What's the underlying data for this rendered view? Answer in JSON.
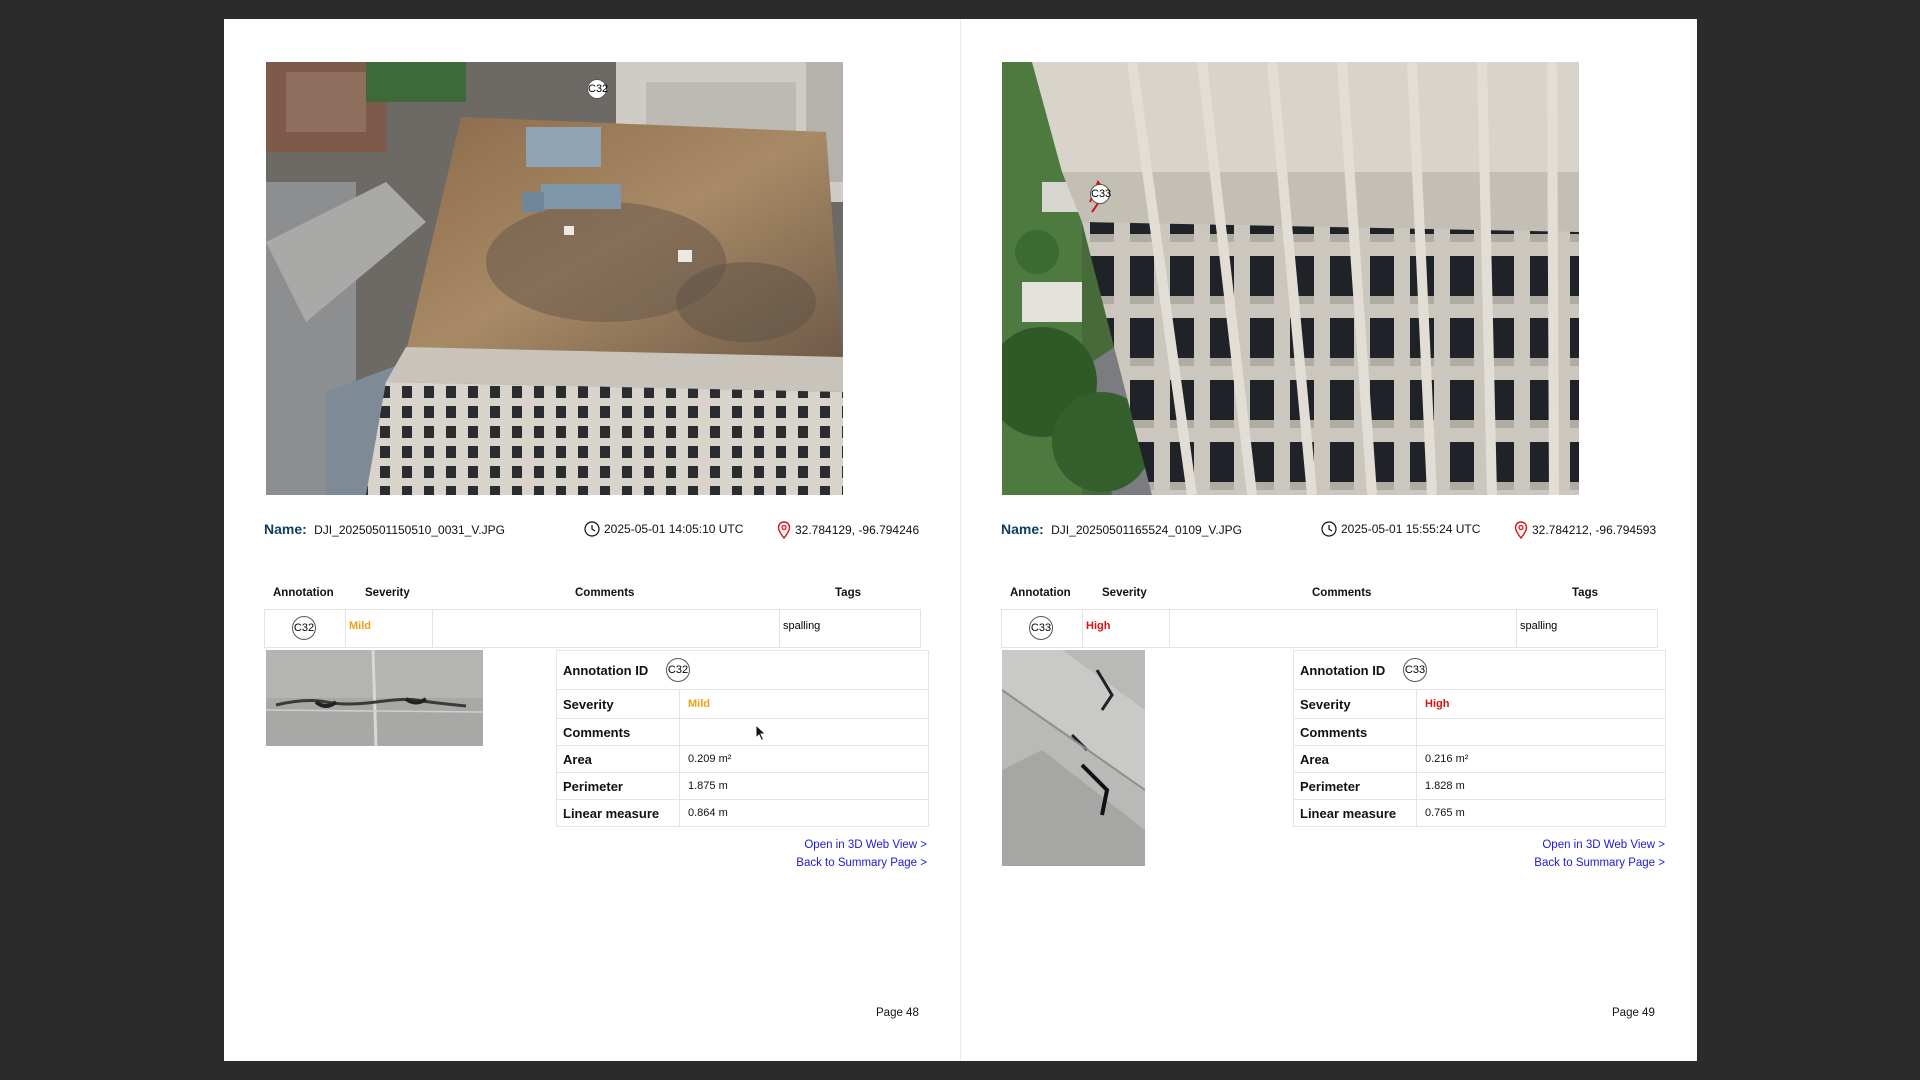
{
  "pages": [
    {
      "marker": "C32",
      "name_label": "Name:",
      "filename": "DJI_20250501150510_0031_V.JPG",
      "timestamp": "2025-05-01 14:05:10 UTC",
      "coordinates": "32.784129, -96.794246",
      "table_headers": {
        "annotation": "Annotation",
        "severity": "Severity",
        "comments": "Comments",
        "tags": "Tags"
      },
      "row": {
        "annotation": "C32",
        "severity": "Mild",
        "comments": "",
        "tags": "spalling"
      },
      "detail": {
        "id_label": "Annotation ID",
        "id": "C32",
        "severity_label": "Severity",
        "severity": "Mild",
        "comments_label": "Comments",
        "comments": "",
        "area_label": "Area",
        "area": "0.209 m²",
        "perimeter_label": "Perimeter",
        "perimeter": "1.875 m",
        "linear_label": "Linear measure",
        "linear": "0.864 m"
      },
      "link_3d": "Open in 3D Web View >",
      "link_summary": "Back to Summary Page >",
      "page_number": "Page 48"
    },
    {
      "marker": "C33",
      "name_label": "Name:",
      "filename": "DJI_20250501165524_0109_V.JPG",
      "timestamp": "2025-05-01 15:55:24 UTC",
      "coordinates": "32.784212, -96.794593",
      "table_headers": {
        "annotation": "Annotation",
        "severity": "Severity",
        "comments": "Comments",
        "tags": "Tags"
      },
      "row": {
        "annotation": "C33",
        "severity": "High",
        "comments": "",
        "tags": "spalling"
      },
      "detail": {
        "id_label": "Annotation ID",
        "id": "C33",
        "severity_label": "Severity",
        "severity": "High",
        "comments_label": "Comments",
        "comments": "",
        "area_label": "Area",
        "area": "0.216 m²",
        "perimeter_label": "Perimeter",
        "perimeter": "1.828 m",
        "linear_label": "Linear measure",
        "linear": "0.765 m"
      },
      "link_3d": "Open in 3D Web View >",
      "link_summary": "Back to Summary Page >",
      "page_number": "Page 49"
    }
  ],
  "colors": {
    "mild": "#f0a010",
    "high": "#e01010",
    "link": "#1a1ad8",
    "name_label": "#0e3c5e"
  }
}
